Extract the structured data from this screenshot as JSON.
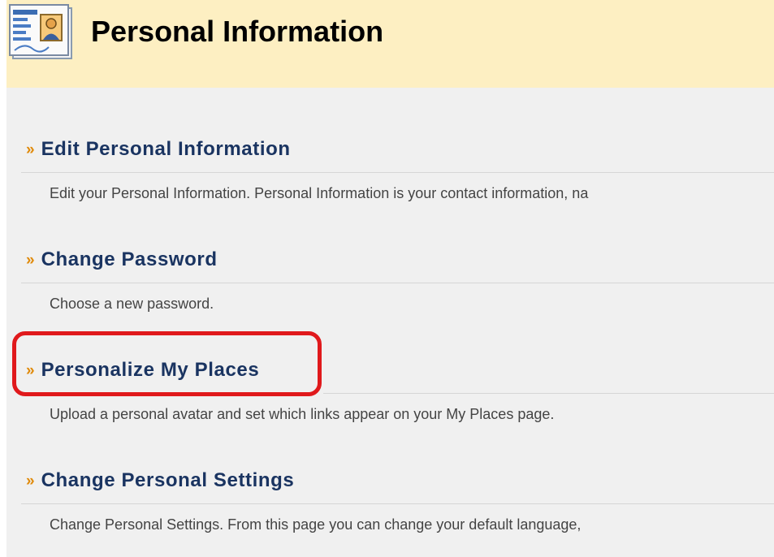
{
  "header": {
    "title": "Personal Information",
    "icon": "personal-info-card-icon"
  },
  "sections": [
    {
      "title": "Edit Personal Information",
      "description": "Edit your Personal Information. Personal Information is your contact information, na"
    },
    {
      "title": "Change Password",
      "description": "Choose a new password."
    },
    {
      "title": "Personalize My Places",
      "description": "Upload a personal avatar and set which links appear on your My Places page."
    },
    {
      "title": "Change Personal Settings",
      "description": "Change Personal Settings. From this page you can change your default language,"
    }
  ],
  "bullet_glyph": "»",
  "colors": {
    "header_bg": "#fdefc2",
    "page_bg": "#f0f0f0",
    "link": "#1a3461",
    "bullet": "#e08a0a",
    "highlight": "#e0191c"
  }
}
